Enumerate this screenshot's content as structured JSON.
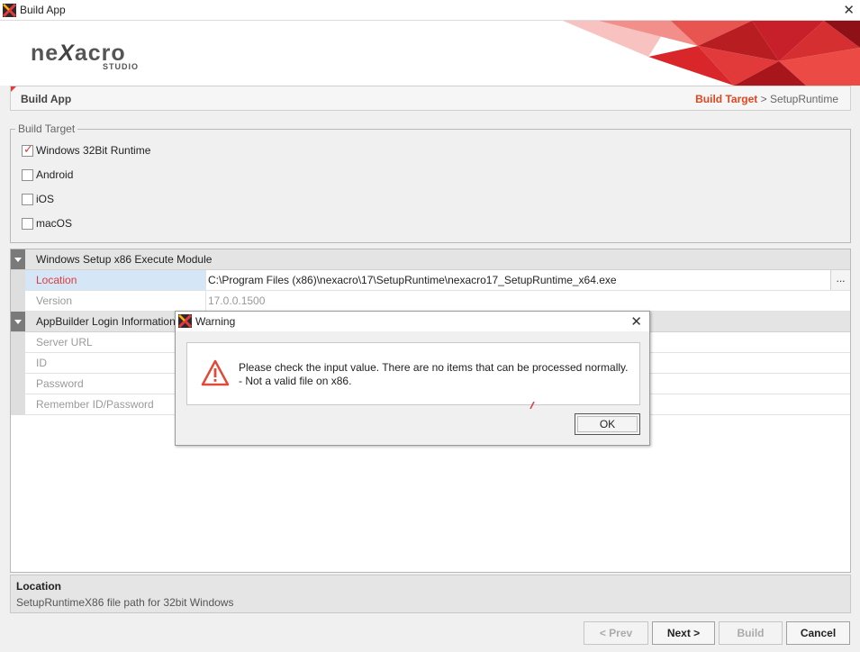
{
  "window": {
    "title": "Build App"
  },
  "logo": {
    "text_pre": "ne",
    "text_x": "X",
    "text_post": "acro",
    "sub": "STUDIO"
  },
  "breadcrumb": {
    "page_title": "Build App",
    "active": "Build Target",
    "sep": ">",
    "next": "SetupRuntime"
  },
  "build_target": {
    "legend": "Build Target",
    "options": [
      {
        "label": "Windows 32Bit Runtime",
        "checked": true
      },
      {
        "label": "Android",
        "checked": false
      },
      {
        "label": "iOS",
        "checked": false
      },
      {
        "label": "macOS",
        "checked": false
      }
    ]
  },
  "props": {
    "section1": "Windows Setup x86 Execute Module",
    "location_name": "Location",
    "location_value": "C:\\Program Files (x86)\\nexacro\\17\\SetupRuntime\\nexacro17_SetupRuntime_x64.exe",
    "browse": "...",
    "version_name": "Version",
    "version_value": "17.0.0.1500",
    "section2": "AppBuilder Login Information",
    "server_url": "Server URL",
    "id": "ID",
    "password": "Password",
    "remember": "Remember ID/Password"
  },
  "description": {
    "title": "Location",
    "text": "SetupRuntimeX86 file path for 32bit Windows"
  },
  "buttons": {
    "prev": "< Prev",
    "next": "Next >",
    "build": "Build",
    "cancel": "Cancel"
  },
  "dialog": {
    "title": "Warning",
    "line1": "Please check the input value. There are no items that can be processed normally.",
    "line2": "- Not a valid file on x86.",
    "ok": "OK"
  },
  "colors": {
    "accent": "#e23a3a",
    "crumb_active": "#e0461f",
    "selection": "#d5e6f6"
  },
  "icons": [
    "app-icon",
    "close-icon",
    "warning-icon",
    "checkbox-icon",
    "collapse-icon"
  ]
}
